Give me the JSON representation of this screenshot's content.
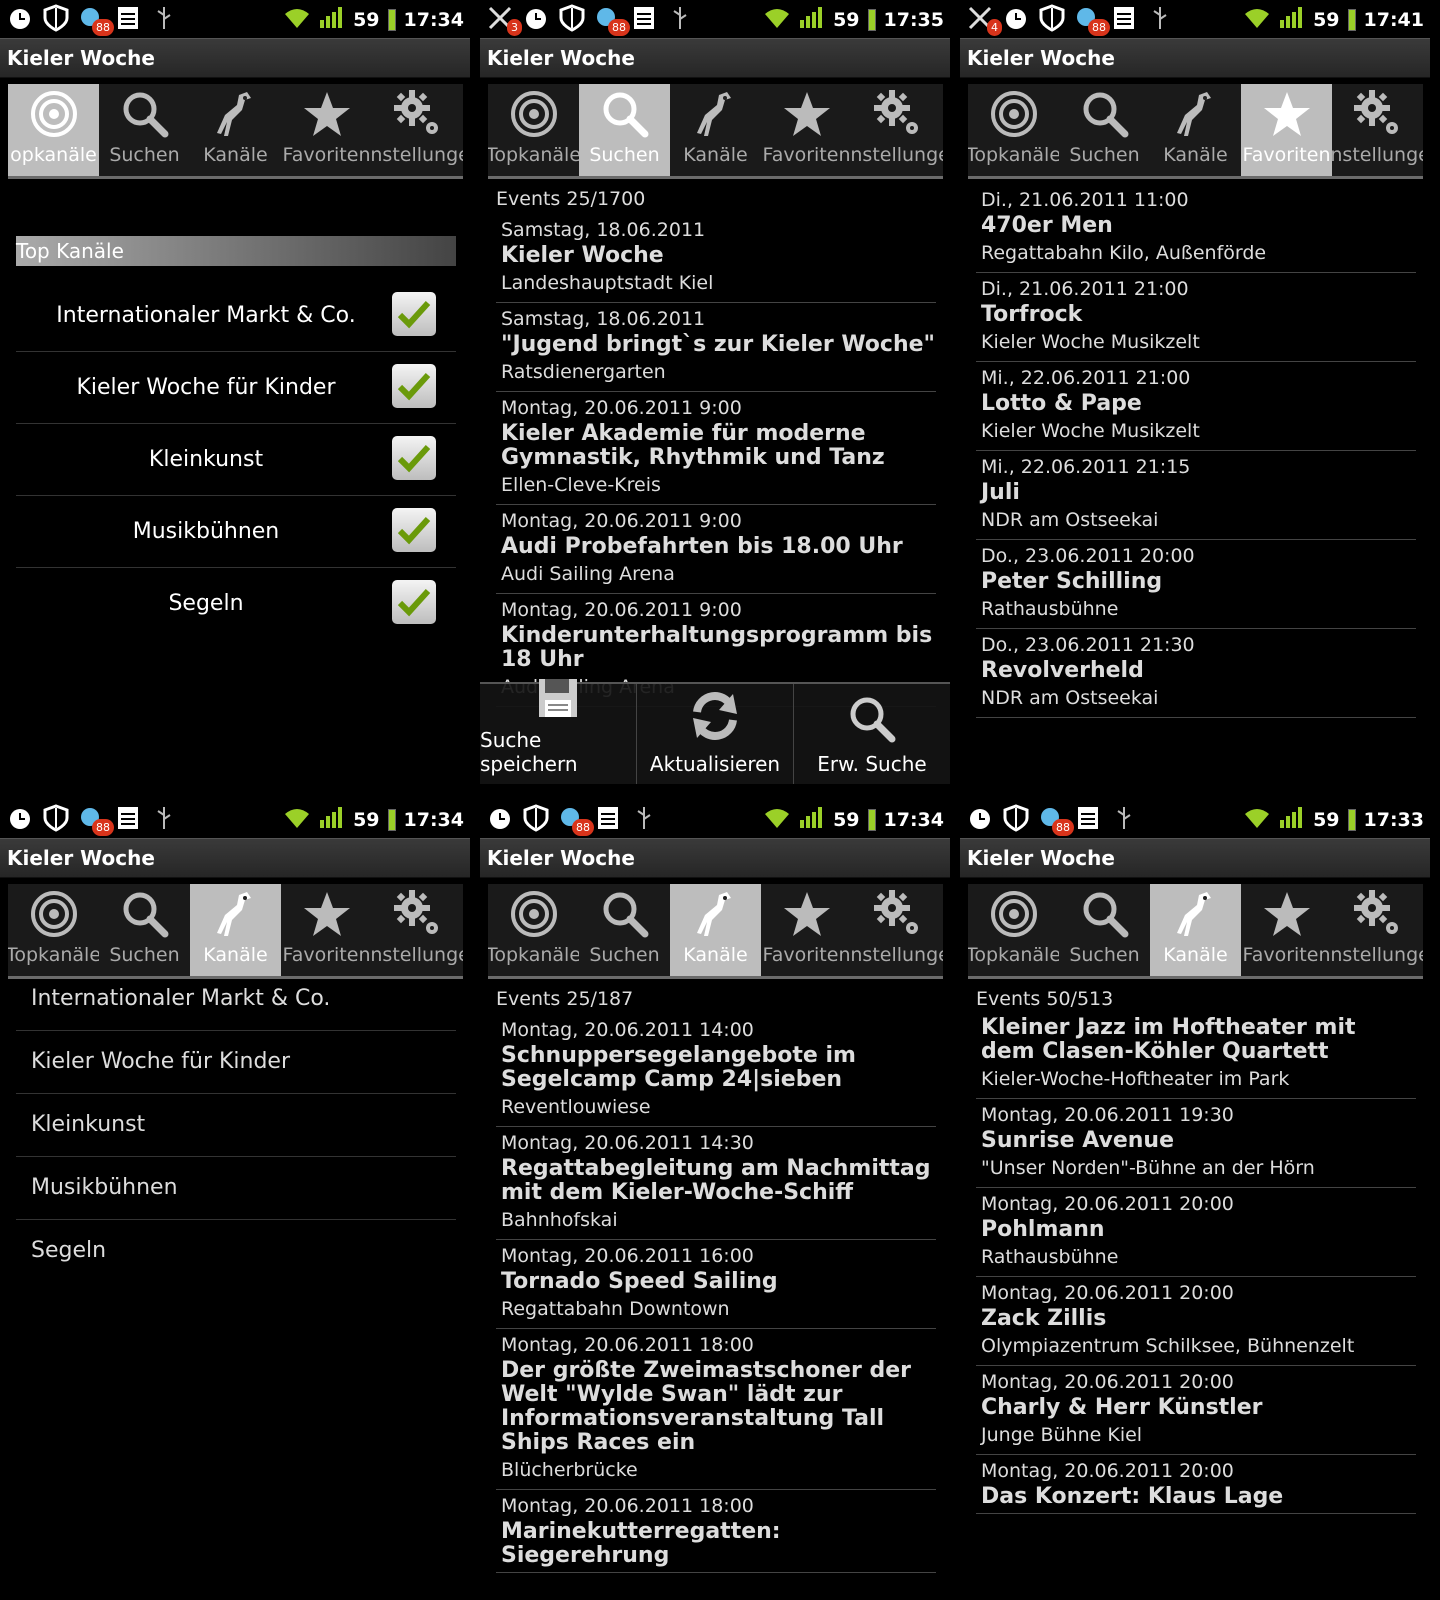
{
  "app_title": "Kieler Woche",
  "tabs": [
    "Topkanäle",
    "Suchen",
    "Kanäle",
    "Favoriten",
    "Einstellungen"
  ],
  "screens": {
    "s1": {
      "time": "17:34",
      "battery": "59",
      "notif_count": "88",
      "tab_partial": "opkanäle"
    },
    "s2": {
      "time": "17:35",
      "battery": "59",
      "notif_count": "88",
      "extra_badge": "3"
    },
    "s3": {
      "time": "17:41",
      "battery": "59",
      "notif_count": "88",
      "extra_badge": "4"
    },
    "s4": {
      "time": "17:34",
      "battery": "59",
      "notif_count": "88"
    },
    "s5": {
      "time": "17:34",
      "battery": "59",
      "notif_count": "88"
    },
    "s6": {
      "time": "17:33",
      "battery": "59",
      "notif_count": "88"
    }
  },
  "topkanaele": {
    "header": "Top Kanäle",
    "items": [
      "Internationaler Markt & Co.",
      "Kieler Woche für Kinder",
      "Kleinkunst",
      "Musikbühnen",
      "Segeln"
    ]
  },
  "search": {
    "count": "Events 25/1700",
    "events": [
      {
        "date": "Samstag, 18.06.2011",
        "title": "Kieler Woche",
        "loc": "Landeshauptstadt Kiel"
      },
      {
        "date": "Samstag, 18.06.2011",
        "title": "\"Jugend bringt`s zur Kieler Woche\"",
        "loc": "Ratsdienergarten"
      },
      {
        "date": "Montag, 20.06.2011 9:00",
        "title": "Kieler Akademie für moderne Gymnastik, Rhythmik und Tanz",
        "loc": "Ellen-Cleve-Kreis"
      },
      {
        "date": "Montag, 20.06.2011 9:00",
        "title": "Audi Probefahrten bis 18.00 Uhr",
        "loc": "Audi Sailing Arena"
      },
      {
        "date": "Montag, 20.06.2011 9:00",
        "title": "Kinderunterhaltungsprogramm bis 18 Uhr",
        "loc": "Audi Sailing Arena"
      }
    ],
    "menu": [
      "Suche speichern",
      "Aktualisieren",
      "Erw. Suche"
    ]
  },
  "favoriten": {
    "events": [
      {
        "date": "Di., 21.06.2011 11:00",
        "title": "470er Men",
        "loc": "Regattabahn Kilo, Außenförde"
      },
      {
        "date": "Di., 21.06.2011 21:00",
        "title": "Torfrock",
        "loc": "Kieler Woche Musikzelt"
      },
      {
        "date": "Mi., 22.06.2011 21:00",
        "title": "Lotto & Pape",
        "loc": "Kieler Woche Musikzelt"
      },
      {
        "date": "Mi., 22.06.2011 21:15",
        "title": "Juli",
        "loc": "NDR am Ostseekai"
      },
      {
        "date": "Do., 23.06.2011 20:00",
        "title": "Peter Schilling",
        "loc": "Rathausbühne"
      },
      {
        "date": "Do., 23.06.2011 21:30",
        "title": "Revolverheld",
        "loc": "NDR am Ostseekai"
      }
    ]
  },
  "kanaele": {
    "items": [
      "Internationaler Markt & Co.",
      "Kieler Woche für Kinder",
      "Kleinkunst",
      "Musikbühnen",
      "Segeln"
    ]
  },
  "kanal_a": {
    "count": "Events 25/187",
    "events": [
      {
        "date": "Montag, 20.06.2011 14:00",
        "title": "Schnuppersegelangebote im Segelcamp Camp 24|sieben",
        "loc": "Reventlouwiese"
      },
      {
        "date": "Montag, 20.06.2011 14:30",
        "title": "Regattabegleitung am Nachmittag mit dem Kieler-Woche-Schiff",
        "loc": "Bahnhofskai"
      },
      {
        "date": "Montag, 20.06.2011 16:00",
        "title": "Tornado Speed Sailing",
        "loc": "Regattabahn Downtown"
      },
      {
        "date": "Montag, 20.06.2011 18:00",
        "title": "Der größte Zweimastschoner der Welt \"Wylde Swan\" lädt zur Informationsveranstaltung Tall Ships Races ein",
        "loc": "Blücherbrücke"
      },
      {
        "date": "Montag, 20.06.2011 18:00",
        "title": "Marinekutterregatten: Siegerehrung",
        "loc": ""
      }
    ]
  },
  "kanal_b": {
    "count": "Events 50/513",
    "events": [
      {
        "date": "",
        "title": "Kleiner Jazz im Hoftheater mit dem Clasen-Köhler Quartett",
        "loc": "Kieler-Woche-Hoftheater im Park"
      },
      {
        "date": "Montag, 20.06.2011 19:30",
        "title": "Sunrise Avenue",
        "loc": "\"Unser Norden\"-Bühne an der Hörn"
      },
      {
        "date": "Montag, 20.06.2011 20:00",
        "title": "Pohlmann",
        "loc": "Rathausbühne"
      },
      {
        "date": "Montag, 20.06.2011 20:00",
        "title": "Zack Zillis",
        "loc": "Olympiazentrum Schilksee, Bühnenzelt"
      },
      {
        "date": "Montag, 20.06.2011 20:00",
        "title": "Charly & Herr Künstler",
        "loc": "Junge Bühne Kiel"
      },
      {
        "date": "Montag, 20.06.2011 20:00",
        "title": "Das Konzert: Klaus Lage",
        "loc": ""
      }
    ]
  }
}
